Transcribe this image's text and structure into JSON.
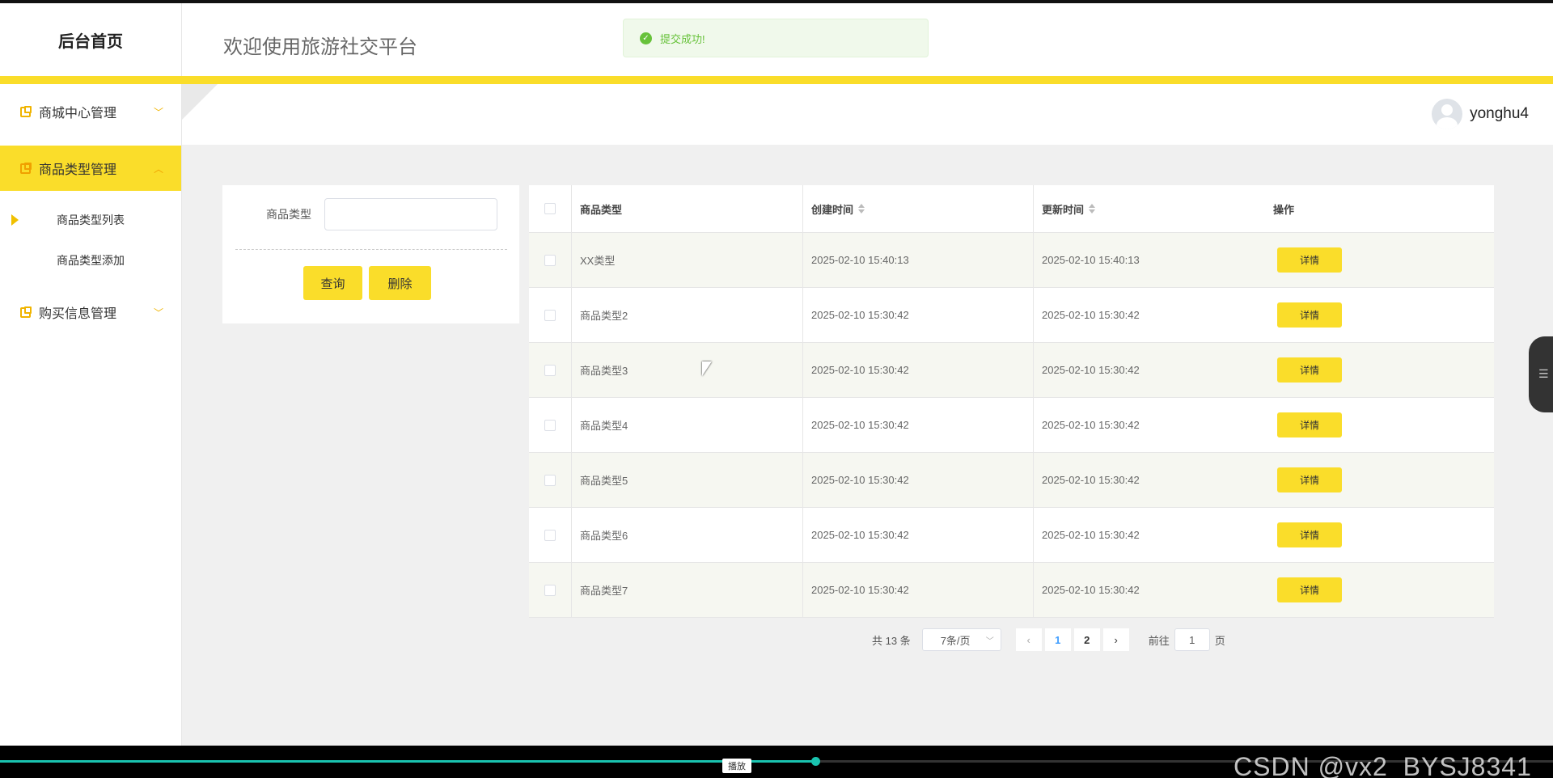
{
  "header": {
    "brand": "后台首页",
    "welcome": "欢迎使用旅游社交平台"
  },
  "toast": {
    "message": "提交成功!",
    "icon": "check-circle-icon",
    "color": "#67c23a"
  },
  "sidebar": {
    "items": [
      {
        "label": "商城中心管理",
        "icon": "menu-box-icon",
        "expanded": false
      },
      {
        "label": "商品类型管理",
        "icon": "menu-box-icon",
        "expanded": true,
        "active": true
      },
      {
        "label": "购买信息管理",
        "icon": "menu-box-icon",
        "expanded": false
      }
    ],
    "subitems": [
      {
        "label": "商品类型列表",
        "active": true
      },
      {
        "label": "商品类型添加"
      }
    ]
  },
  "user": {
    "name": "yonghu4"
  },
  "search": {
    "label": "商品类型",
    "value": "",
    "query_button": "查询",
    "delete_button": "删除"
  },
  "table": {
    "columns": [
      "商品类型",
      "创建时间",
      "更新时间",
      "操作"
    ],
    "rows": [
      {
        "type": "XX类型",
        "created": "2025-02-10 15:40:13",
        "updated": "2025-02-10 15:40:13",
        "action": "详情"
      },
      {
        "type": "商品类型2",
        "created": "2025-02-10 15:30:42",
        "updated": "2025-02-10 15:30:42",
        "action": "详情"
      },
      {
        "type": "商品类型3",
        "created": "2025-02-10 15:30:42",
        "updated": "2025-02-10 15:30:42",
        "action": "详情"
      },
      {
        "type": "商品类型4",
        "created": "2025-02-10 15:30:42",
        "updated": "2025-02-10 15:30:42",
        "action": "详情"
      },
      {
        "type": "商品类型5",
        "created": "2025-02-10 15:30:42",
        "updated": "2025-02-10 15:30:42",
        "action": "详情"
      },
      {
        "type": "商品类型6",
        "created": "2025-02-10 15:30:42",
        "updated": "2025-02-10 15:30:42",
        "action": "详情"
      },
      {
        "type": "商品类型7",
        "created": "2025-02-10 15:30:42",
        "updated": "2025-02-10 15:30:42",
        "action": "详情"
      }
    ]
  },
  "pagination": {
    "total": "共 13 条",
    "page_size": "7条/页",
    "pages": [
      "1",
      "2"
    ],
    "current": "1",
    "goto_label": "前往",
    "goto_value": "1",
    "page_suffix": "页"
  },
  "player": {
    "tooltip": "播放",
    "watermark": "CSDN @vx2_BYSJ8341",
    "progress_fraction": 0.525
  },
  "colors": {
    "accent": "#fadd2a",
    "active_page": "#409eff",
    "progress": "#1ac4b0"
  }
}
